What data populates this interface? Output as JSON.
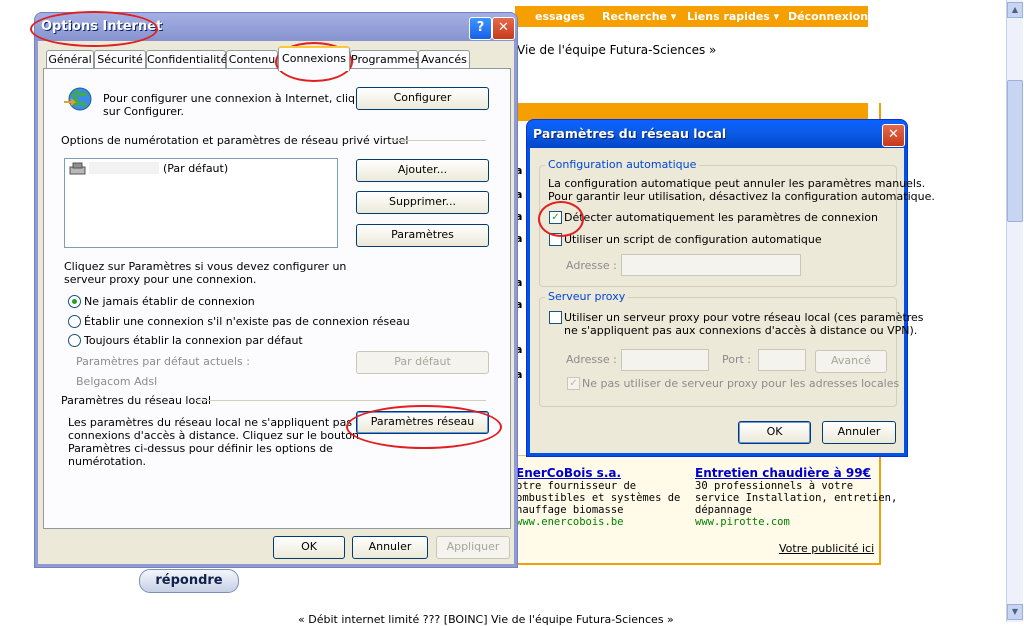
{
  "background": {
    "topnav": [
      "essages",
      "Recherche ▾",
      "Liens rapides ▾",
      "Déconnexion"
    ],
    "team_link_top": "Vie de l'équipe Futura-Sciences »",
    "side_letters": [
      "a",
      "a",
      "a",
      "a",
      "a",
      "a",
      "a",
      "a"
    ],
    "ads": [
      {
        "title": "EnerCoBois s.a.",
        "lines": [
          "otre fournisseur de",
          "ombustibles et systèmes de",
          "hauffage biomasse"
        ],
        "url": "www.enercobois.be"
      },
      {
        "title": "Entretien chaudière à 99€",
        "lines": [
          "30 professionnels à votre",
          "service Installation, entretien,",
          "dépannage"
        ],
        "url": "www.pirotte.com"
      }
    ],
    "ad_footer": "Votre publicité ici",
    "reply_button": "répondre",
    "bottom_nav": "« Débit internet limité ???   [BOINC] Vie de l'équipe Futura-Sciences »"
  },
  "ie_dialog": {
    "title": "Options Internet",
    "tabs": [
      "Général",
      "Sécurité",
      "Confidentialité",
      "Contenu",
      "Connexions",
      "Programmes",
      "Avancés"
    ],
    "active_tab": "Connexions",
    "setup_text": [
      "Pour configurer une connexion à Internet, cliquez",
      "sur Configurer."
    ],
    "setup_button": "Configurer",
    "dialup_header": "Options de numérotation et paramètres de réseau privé virtuel",
    "dialup_list": [
      {
        "label": "(Par défaut)"
      }
    ],
    "add_button": "Ajouter...",
    "remove_button": "Supprimer...",
    "settings_button": "Paramètres",
    "proxy_hint": [
      "Cliquez sur Paramètres si vous devez configurer un",
      "serveur proxy pour une connexion."
    ],
    "radios": [
      {
        "label": "Ne jamais établir de connexion",
        "checked": true
      },
      {
        "label": "Établir une connexion s'il n'existe pas de connexion réseau",
        "checked": false
      },
      {
        "label": "Toujours établir la connexion par défaut",
        "checked": false
      }
    ],
    "current_default_label": "Paramètres par défaut actuels :",
    "current_default_value": "Belgacom Adsl",
    "set_default_button": "Par défaut",
    "lan_header": "Paramètres du réseau local",
    "lan_text": [
      "Les paramètres du réseau local ne s'appliquent pas aux",
      "connexions d'accès à distance. Cliquez sur le bouton",
      "Paramètres ci-dessus pour définir les options de",
      "numérotation."
    ],
    "lan_button": "Paramètres réseau",
    "ok_button": "OK",
    "cancel_button": "Annuler",
    "apply_button": "Appliquer"
  },
  "lan_dialog": {
    "title": "Paramètres du réseau local",
    "auto_group": "Configuration automatique",
    "auto_text": [
      "La configuration automatique peut annuler les paramètres manuels.",
      "Pour garantir leur utilisation, désactivez la configuration automatique."
    ],
    "auto_detect_label": "Détecter automatiquement les paramètres de connexion",
    "auto_detect_checked": true,
    "auto_script_label": "Utiliser un script de configuration automatique",
    "auto_script_checked": false,
    "address_label": "Adresse :",
    "proxy_group": "Serveur proxy",
    "proxy_label": [
      "Utiliser un serveur proxy pour votre réseau local (ces paramètres",
      "ne s'appliquent pas aux connexions d'accès à distance ou VPN)."
    ],
    "proxy_checked": false,
    "proxy_address_label": "Adresse :",
    "port_label": "Port :",
    "advanced_button": "Avancé",
    "bypass_label": "Ne pas utiliser de serveur proxy pour les adresses locales",
    "ok_button": "OK",
    "cancel_button": "Annuler"
  }
}
